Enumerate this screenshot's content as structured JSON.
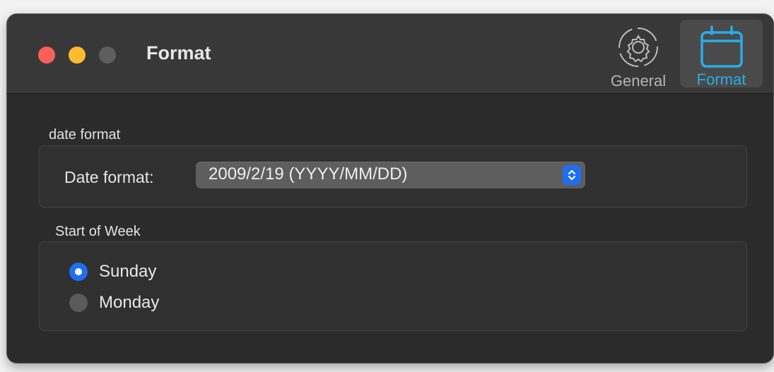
{
  "window": {
    "title": "Format",
    "traffic_lights": [
      "close",
      "minimize",
      "zoom"
    ]
  },
  "toolbar": {
    "items": [
      {
        "label": "General",
        "icon": "gear-icon",
        "selected": false
      },
      {
        "label": "Format",
        "icon": "calendar-icon",
        "selected": true
      }
    ]
  },
  "date_section": {
    "heading": "date format",
    "field_label": "Date format:",
    "selected_value": "2009/2/19 (YYYY/MM/DD)"
  },
  "week_section": {
    "heading": "Start of Week",
    "options": [
      {
        "label": "Sunday",
        "checked": true
      },
      {
        "label": "Monday",
        "checked": false
      }
    ]
  },
  "colors": {
    "accent": "#1f6ef2",
    "toolbar_selected_text": "#27aeea",
    "close": "#ff5f57",
    "minimize": "#febc2e",
    "zoom_inactive": "#5e5e5e"
  }
}
